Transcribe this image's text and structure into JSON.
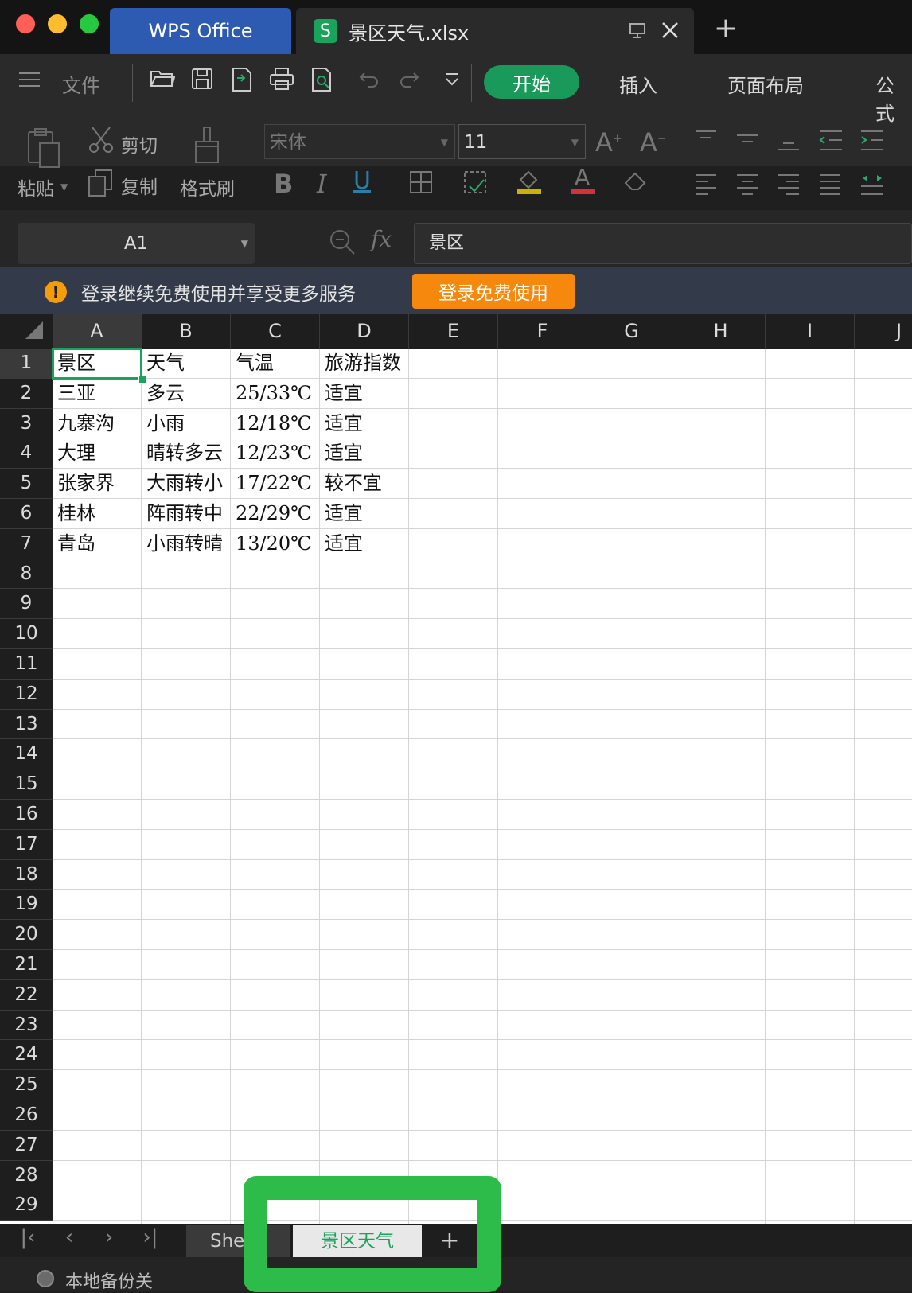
{
  "titlebar": {
    "app_tab": "WPS Office",
    "doc_tab": "景区天气.xlsx",
    "doc_tab_icon": "S"
  },
  "menubar": {
    "file": "文件",
    "start": "开始",
    "insert": "插入",
    "page_layout": "页面布局",
    "formula": "公式"
  },
  "ribbon": {
    "cut": "剪切",
    "copy": "复制",
    "paste": "粘贴",
    "format_painter": "格式刷",
    "font_name": "宋体",
    "font_size": "11"
  },
  "formula_bar": {
    "name_box": "A1",
    "fx": "fx",
    "content": "景区"
  },
  "notice": {
    "icon": "!",
    "text": "登录继续免费使用并享受更多服务",
    "button": "登录免费使用"
  },
  "grid": {
    "columns": [
      "A",
      "B",
      "C",
      "D",
      "E",
      "F",
      "G",
      "H",
      "I",
      "J"
    ],
    "rows": [
      "1",
      "2",
      "3",
      "4",
      "5",
      "6",
      "7",
      "8",
      "9",
      "10",
      "11",
      "12",
      "13",
      "14",
      "15",
      "16",
      "17",
      "18",
      "19",
      "20",
      "21",
      "22",
      "23",
      "24",
      "25",
      "26",
      "27",
      "28",
      "29"
    ],
    "data": [
      [
        "景区",
        "天气",
        "气温",
        "旅游指数"
      ],
      [
        "三亚",
        "多云",
        "25/33℃",
        "适宜"
      ],
      [
        "九寨沟",
        "小雨",
        "12/18℃",
        "适宜"
      ],
      [
        "大理",
        "晴转多云",
        "12/23℃",
        "适宜"
      ],
      [
        "张家界",
        "大雨转小",
        "17/22℃",
        "较不宜"
      ],
      [
        "桂林",
        "阵雨转中",
        "22/29℃",
        "适宜"
      ],
      [
        "青岛",
        "小雨转晴",
        "13/20℃",
        "适宜"
      ]
    ],
    "selected_cell": "A1"
  },
  "sheets": {
    "tab1": "She",
    "tab2": "景区天气",
    "add": "+"
  },
  "status": {
    "backup": "本地备份关"
  },
  "colors": {
    "accent_green": "#1aa35a",
    "highlight": "#2dbb4a",
    "notice_button": "#f6880e",
    "wps_tab": "#2d5bb1"
  }
}
